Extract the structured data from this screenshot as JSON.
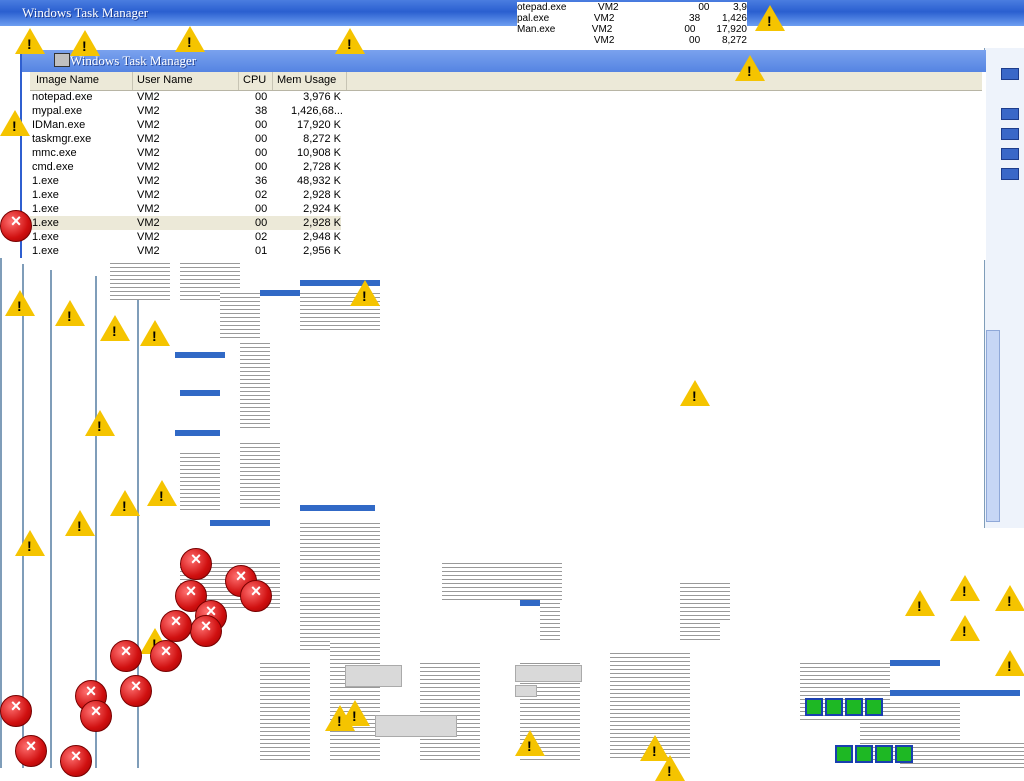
{
  "back_window": {
    "title": "Windows Task Manager",
    "rows": [
      {
        "name": "otepad.exe",
        "user": "VM2",
        "cpu": "00",
        "mem": "3,9"
      },
      {
        "name": "pal.exe",
        "user": "VM2",
        "cpu": "38",
        "mem": "1,426"
      },
      {
        "name": "Man.exe",
        "user": "VM2",
        "cpu": "00",
        "mem": "17,920"
      },
      {
        "name": "",
        "user": "VM2",
        "cpu": "00",
        "mem": "8,272"
      }
    ]
  },
  "task_manager": {
    "title": "Windows Task Manager",
    "columns": {
      "image_name": "Image Name",
      "user_name": "User Name",
      "cpu": "CPU",
      "mem_usage": "Mem Usage"
    },
    "processes": [
      {
        "name": "notepad.exe",
        "user": "VM2",
        "cpu": "00",
        "mem": "3,976 K"
      },
      {
        "name": "mypal.exe",
        "user": "VM2",
        "cpu": "38",
        "mem": "1,426,68..."
      },
      {
        "name": "IDMan.exe",
        "user": "VM2",
        "cpu": "00",
        "mem": "17,920 K"
      },
      {
        "name": "taskmgr.exe",
        "user": "VM2",
        "cpu": "00",
        "mem": "8,272 K"
      },
      {
        "name": "mmc.exe",
        "user": "VM2",
        "cpu": "00",
        "mem": "10,908 K"
      },
      {
        "name": "cmd.exe",
        "user": "VM2",
        "cpu": "00",
        "mem": "2,728 K"
      },
      {
        "name": "1.exe",
        "user": "VM2",
        "cpu": "36",
        "mem": "48,932 K"
      },
      {
        "name": "1.exe",
        "user": "VM2",
        "cpu": "02",
        "mem": "2,928 K"
      },
      {
        "name": "1.exe",
        "user": "VM2",
        "cpu": "00",
        "mem": "2,924 K"
      },
      {
        "name": "1.exe",
        "user": "VM2",
        "cpu": "00",
        "mem": "2,928 K",
        "selected": true
      },
      {
        "name": "1.exe",
        "user": "VM2",
        "cpu": "02",
        "mem": "2,948 K"
      },
      {
        "name": "1.exe",
        "user": "VM2",
        "cpu": "01",
        "mem": "2,956 K"
      }
    ]
  },
  "icons": {
    "warning": "warning-icon",
    "error": "error-icon",
    "app": "task-manager-icon"
  },
  "colors": {
    "title_blue": "#2a5fd0",
    "header_grey": "#ece9d8",
    "warning_yellow": "#f5c400",
    "error_red": "#d01010"
  }
}
